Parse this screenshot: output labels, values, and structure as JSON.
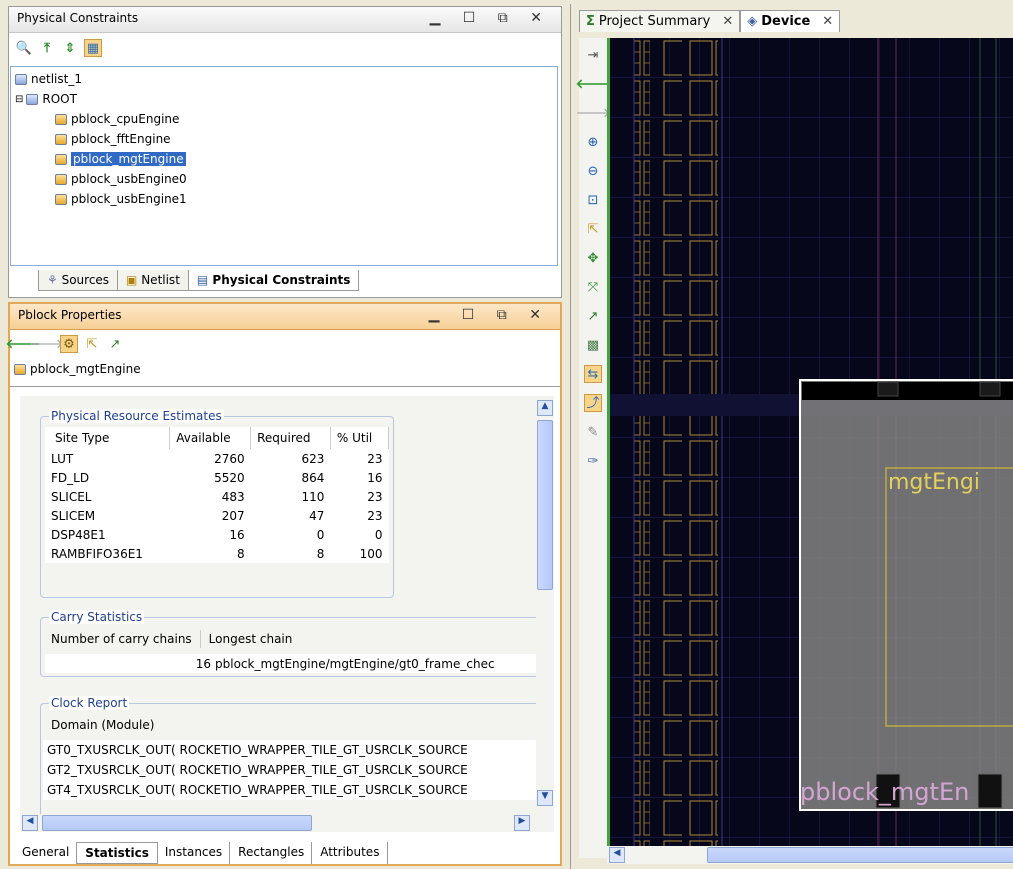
{
  "constraints_panel": {
    "title": "Physical Constraints",
    "tree": {
      "netlist": "netlist_1",
      "root": "ROOT",
      "children": [
        "pblock_cpuEngine",
        "pblock_fftEngine",
        "pblock_mgtEngine",
        "pblock_usbEngine0",
        "pblock_usbEngine1"
      ],
      "selected": "pblock_mgtEngine"
    },
    "tabs": [
      "Sources",
      "Netlist",
      "Physical Constraints"
    ],
    "active_tab": "Physical Constraints"
  },
  "properties_panel": {
    "title": "Pblock Properties",
    "object_name": "pblock_mgtEngine",
    "resource_group_title": "Physical Resource Estimates",
    "resource_headers": [
      "Site Type",
      "Available",
      "Required",
      "% Util"
    ],
    "resource_rows": [
      [
        "LUT",
        "2760",
        "623",
        "23"
      ],
      [
        "FD_LD",
        "5520",
        "864",
        "16"
      ],
      [
        "SLICEL",
        "483",
        "110",
        "23"
      ],
      [
        "SLICEM",
        "207",
        "47",
        "23"
      ],
      [
        "DSP48E1",
        "16",
        "0",
        "0"
      ],
      [
        "RAMBFIFO36E1",
        "8",
        "8",
        "100"
      ]
    ],
    "carry_group_title": "Carry Statistics",
    "carry_headers": [
      "Number of carry chains",
      "Longest chain"
    ],
    "carry_count": "16",
    "carry_longest": "pblock_mgtEngine/mgtEngine/gt0_frame_chec",
    "clock_group_title": "Clock Report",
    "clock_header": "Domain (Module)",
    "clock_rows": [
      "GT0_TXUSRCLK_OUT( ROCKETIO_WRAPPER_TILE_GT_USRCLK_SOURCE",
      "GT2_TXUSRCLK_OUT( ROCKETIO_WRAPPER_TILE_GT_USRCLK_SOURCE",
      "GT4_TXUSRCLK_OUT( ROCKETIO_WRAPPER_TILE_GT_USRCLK_SOURCE"
    ],
    "tabs": [
      "General",
      "Statistics",
      "Instances",
      "Rectangles",
      "Attributes"
    ],
    "active_tab": "Statistics"
  },
  "editor": {
    "tabs": [
      "Project Summary",
      "Device"
    ],
    "active_tab": "Device",
    "pblock_labels": [
      "mgtEngi",
      "pblock_mgtEn"
    ]
  },
  "colors": {
    "accent_orange": "#f6cf96",
    "selection": "#316ac5",
    "device_bg": "#07071c",
    "pblock_fill": "#808080"
  }
}
